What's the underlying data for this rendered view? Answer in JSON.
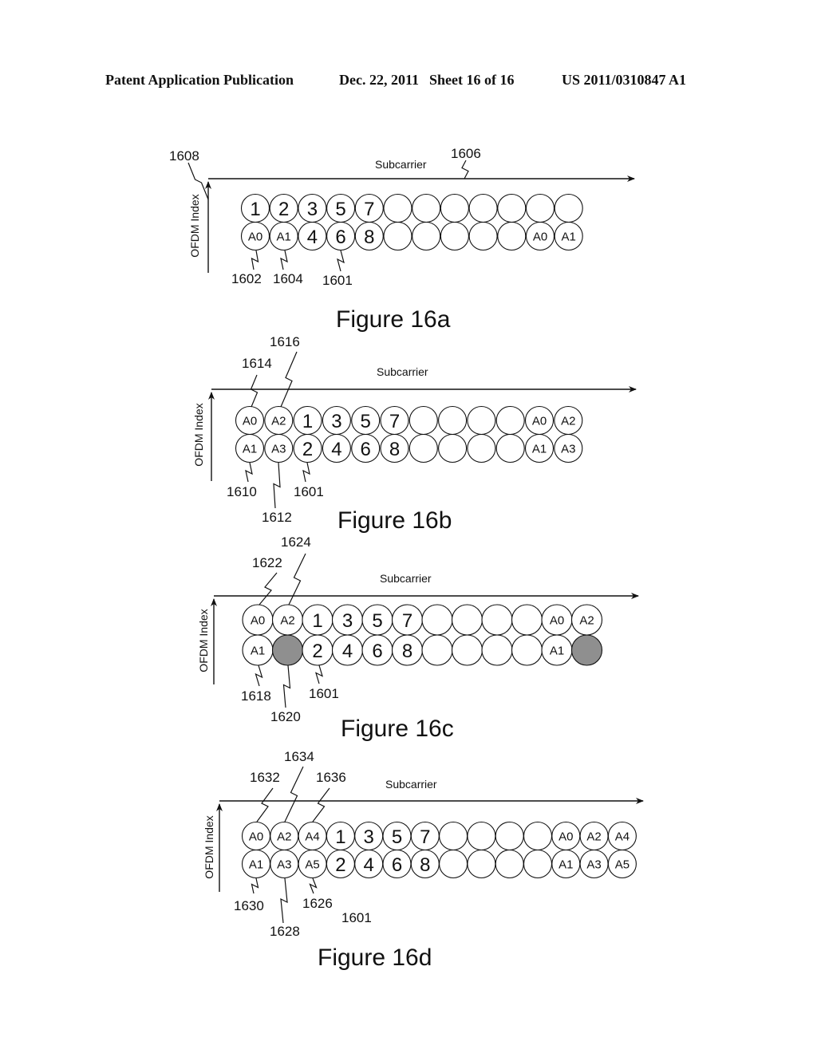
{
  "header": {
    "publication": "Patent Application Publication",
    "date": "Dec. 22, 2011",
    "sheet": "Sheet 16 of 16",
    "number": "US 2011/0310847 A1"
  },
  "colors": {
    "ink": "#111111",
    "shaded_cell": "#8f8f8f"
  },
  "figures": [
    {
      "id": "16a",
      "caption": "Figure 16a",
      "x_axis_label": "Subcarrier",
      "y_axis_label": "OFDM Index",
      "rows": [
        [
          "1",
          "2",
          "3",
          "5",
          "7",
          "",
          "",
          "",
          "",
          "",
          "",
          ""
        ],
        [
          "A0",
          "A1",
          "4",
          "6",
          "8",
          "",
          "",
          "",
          "",
          "",
          "A0",
          "A1"
        ]
      ],
      "shaded": [],
      "refs": [
        "1608",
        "1606",
        "1602",
        "1604",
        "1601"
      ]
    },
    {
      "id": "16b",
      "caption": "Figure 16b",
      "x_axis_label": "Subcarrier",
      "y_axis_label": "OFDM Index",
      "rows": [
        [
          "A0",
          "A2",
          "1",
          "3",
          "5",
          "7",
          "",
          "",
          "",
          "",
          "A0",
          "A2"
        ],
        [
          "A1",
          "A3",
          "2",
          "4",
          "6",
          "8",
          "",
          "",
          "",
          "",
          "A1",
          "A3"
        ]
      ],
      "shaded": [],
      "refs": [
        "1616",
        "1614",
        "1610",
        "1612",
        "1601"
      ]
    },
    {
      "id": "16c",
      "caption": "Figure 16c",
      "x_axis_label": "Subcarrier",
      "y_axis_label": "OFDM Index",
      "rows": [
        [
          "A0",
          "A2",
          "1",
          "3",
          "5",
          "7",
          "",
          "",
          "",
          "",
          "A0",
          "A2"
        ],
        [
          "A1",
          "",
          "2",
          "4",
          "6",
          "8",
          "",
          "",
          "",
          "",
          "A1",
          ""
        ]
      ],
      "shaded": [
        [
          1,
          1
        ],
        [
          1,
          11
        ]
      ],
      "refs": [
        "1624",
        "1622",
        "1618",
        "1620",
        "1601"
      ]
    },
    {
      "id": "16d",
      "caption": "Figure 16d",
      "x_axis_label": "Subcarrier",
      "y_axis_label": "OFDM Index",
      "rows": [
        [
          "A0",
          "A2",
          "A4",
          "1",
          "3",
          "5",
          "7",
          "",
          "",
          "",
          "",
          "A0",
          "A2",
          "A4"
        ],
        [
          "A1",
          "A3",
          "A5",
          "2",
          "4",
          "6",
          "8",
          "",
          "",
          "",
          "",
          "A1",
          "A3",
          "A5"
        ]
      ],
      "shaded": [],
      "refs": [
        "1634",
        "1632",
        "1636",
        "1630",
        "1628",
        "1626",
        "1601"
      ]
    }
  ]
}
